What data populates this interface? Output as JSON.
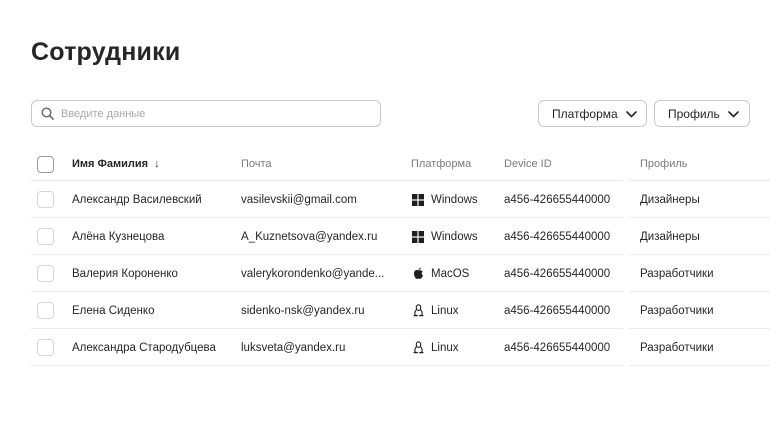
{
  "page": {
    "title": "Сотрудники"
  },
  "search": {
    "placeholder": "Введите данные"
  },
  "filters": {
    "platform_label": "Платформа",
    "profile_label": "Профиль"
  },
  "table": {
    "columns": {
      "name": "Имя Фамилия",
      "sort_indicator": "↓",
      "email": "Почта",
      "platform": "Платформа",
      "device": "Device ID",
      "profile": "Профиль"
    },
    "rows": [
      {
        "name": "Александр Василевский",
        "email": "vasilevskii@gmail.com",
        "platform": "Windows",
        "platform_icon": "windows-icon",
        "device": "a456-426655440000",
        "profile": "Дизайнеры"
      },
      {
        "name": "Алёна Кузнецова",
        "email": "A_Kuznetsova@yandex.ru",
        "platform": "Windows",
        "platform_icon": "windows-icon",
        "device": "a456-426655440000",
        "profile": "Дизайнеры"
      },
      {
        "name": "Валерия Короненко",
        "email": "valerykorondenko@yande...",
        "platform": "MacOS",
        "platform_icon": "apple-icon",
        "device": "a456-426655440000",
        "profile": "Разработчики"
      },
      {
        "name": "Елена Сиденко",
        "email": "sidenko-nsk@yandex.ru",
        "platform": "Linux",
        "platform_icon": "linux-icon",
        "device": "a456-426655440000",
        "profile": "Разработчики"
      },
      {
        "name": "Александра Стародубцева",
        "email": "luksveta@yandex.ru",
        "platform": "Linux",
        "platform_icon": "linux-icon",
        "device": "a456-426655440000",
        "profile": "Разработчики"
      }
    ]
  },
  "icons": {
    "search": "search-icon",
    "chevron": "chevron-down-icon"
  }
}
